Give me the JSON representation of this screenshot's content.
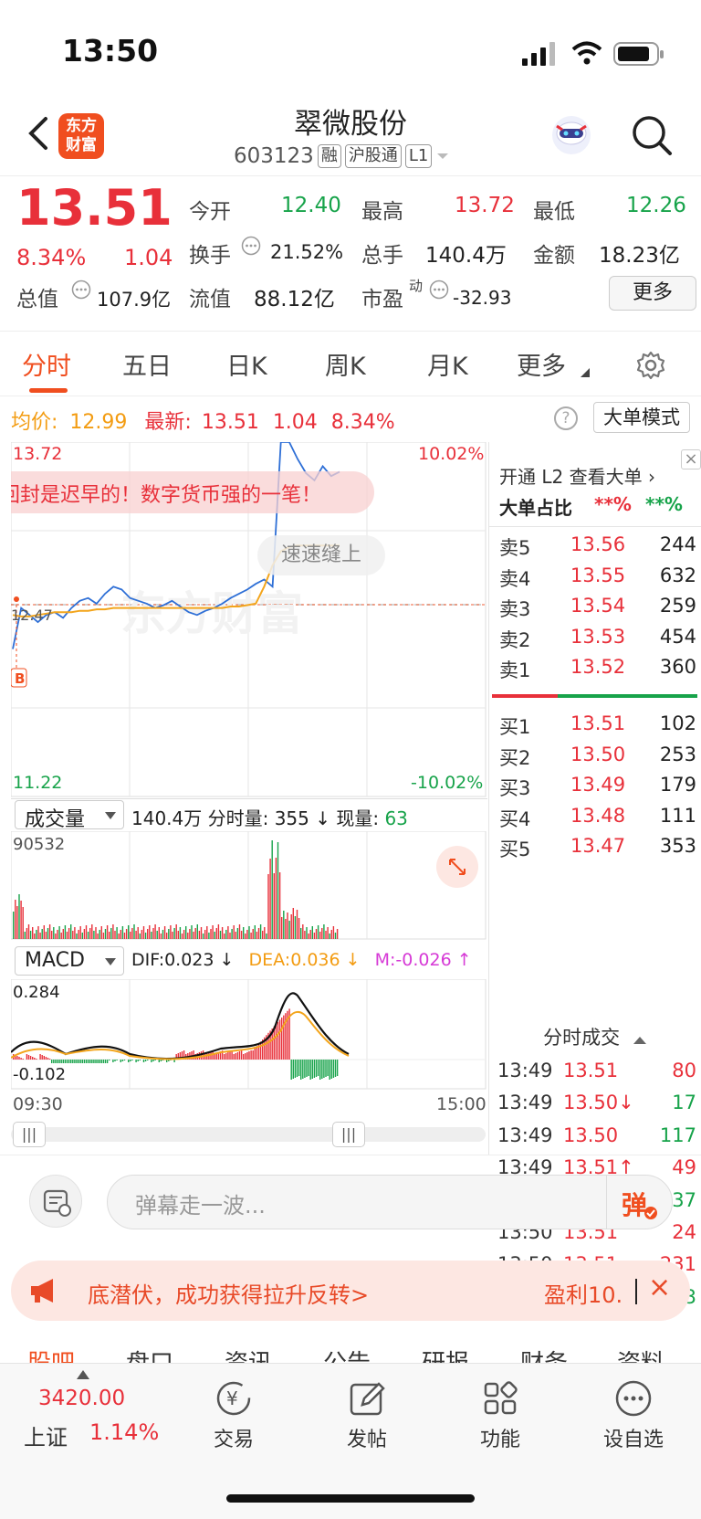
{
  "status": {
    "time": "13:50"
  },
  "header": {
    "logo_text_1": "东方",
    "logo_text_2": "财富",
    "stock_name": "翠微股份",
    "stock_code": "603123",
    "tags": [
      "融",
      "沪股通",
      "L1"
    ]
  },
  "quote": {
    "price": "13.51",
    "change_pct": "8.34%",
    "change": "1.04",
    "open_label": "今开",
    "open": "12.40",
    "high_label": "最高",
    "high": "13.72",
    "low_label": "最低",
    "low": "12.26",
    "turnover_label": "换手",
    "turnover": "21.52%",
    "volume_label": "总手",
    "volume": "140.4万",
    "amount_label": "金额",
    "amount": "18.23亿",
    "mktcap_label": "总值",
    "mktcap": "107.9亿",
    "float_label": "流值",
    "float_cap": "88.12亿",
    "pe_label": "市盈",
    "pe_sup": "动",
    "pe": "-32.93",
    "more_label": "更多"
  },
  "tabs": [
    {
      "label": "分时",
      "active": true
    },
    {
      "label": "五日"
    },
    {
      "label": "日K"
    },
    {
      "label": "周K"
    },
    {
      "label": "月K"
    },
    {
      "label": "更多"
    }
  ],
  "avg_row": {
    "avg_label": "均价:",
    "avg": "12.99",
    "latest_label": "最新:",
    "latest": "13.51",
    "change": "1.04",
    "pct": "8.34%",
    "help": "?",
    "bigorder_label": "大单模式"
  },
  "chart": {
    "top_price": "13.72",
    "bottom_price": "11.22",
    "prev_close_label": "12.47",
    "top_pct": "10.02%",
    "bottom_pct": "-10.02%",
    "danmu_1": "回封是迟早的！数字货币强的一笔！",
    "danmu_2": "速速缝上",
    "watermark": "东方财富",
    "buy_marker": "B",
    "volume_dropdown": "成交量",
    "volume_info": "140.4万 分时量: 355 ↓ 现量: ",
    "volume_now": "63",
    "volume_max": "90532",
    "macd_dropdown": "MACD",
    "dif": "DIF:0.023 ↓",
    "dea": "DEA:0.036 ↓",
    "m": "M:-0.026 ↑",
    "macd_top": "0.284",
    "macd_bottom": "-0.102",
    "time_start": "09:30",
    "time_end": "15:00"
  },
  "chart_data": {
    "type": "line",
    "title": "",
    "ylim": [
      11.22,
      13.72
    ],
    "series": [
      {
        "values": [
          12.26,
          12.55,
          12.5,
          12.45,
          12.5,
          12.52,
          12.48,
          12.55,
          12.6,
          12.62,
          12.58,
          12.65,
          12.7,
          12.68,
          12.62,
          12.6,
          12.58,
          12.55,
          12.57,
          12.6,
          12.56,
          12.52,
          12.5,
          12.53,
          12.55,
          12.58,
          12.62,
          12.65,
          12.68,
          12.72,
          12.75,
          12.7,
          13.72,
          13.72,
          13.6,
          13.5,
          13.45,
          13.55,
          13.48,
          13.51
        ]
      },
      {
        "values": [
          12.5,
          12.49,
          12.49,
          12.5,
          12.51,
          12.52,
          12.52,
          12.52,
          12.53,
          12.53,
          12.54,
          12.54,
          12.55,
          12.55,
          12.55,
          12.55,
          12.55,
          12.55,
          12.55,
          12.55,
          12.55,
          12.55,
          12.55,
          12.55,
          12.55,
          12.55,
          12.56,
          12.56,
          12.57,
          12.58,
          12.7,
          12.85,
          12.95,
          12.98,
          12.99,
          12.99,
          12.99,
          12.99,
          12.99,
          12.99
        ]
      }
    ]
  },
  "right_panel": {
    "l2_label": "开通 L2 查看大单 ›",
    "big_ratio_label": "大单占比",
    "big_ratio_1": "**%",
    "big_ratio_2": "**%",
    "sells": [
      {
        "label": "卖5",
        "price": "13.56",
        "vol": "244"
      },
      {
        "label": "卖4",
        "price": "13.55",
        "vol": "632"
      },
      {
        "label": "卖3",
        "price": "13.54",
        "vol": "259"
      },
      {
        "label": "卖2",
        "price": "13.53",
        "vol": "454"
      },
      {
        "label": "卖1",
        "price": "13.52",
        "vol": "360"
      }
    ],
    "buys": [
      {
        "label": "买1",
        "price": "13.51",
        "vol": "102"
      },
      {
        "label": "买2",
        "price": "13.50",
        "vol": "253"
      },
      {
        "label": "买3",
        "price": "13.49",
        "vol": "179"
      },
      {
        "label": "买4",
        "price": "13.48",
        "vol": "111"
      },
      {
        "label": "买5",
        "price": "13.47",
        "vol": "353"
      }
    ],
    "ticks_label": "分时成交",
    "ticks": [
      {
        "time": "13:49",
        "price": "13.51",
        "vol": "80"
      },
      {
        "time": "13:49",
        "price": "13.50↓",
        "vol": "17"
      },
      {
        "time": "13:49",
        "price": "13.50",
        "vol": "117"
      },
      {
        "time": "13:49",
        "price": "13.51↑",
        "vol": "49"
      },
      {
        "time": "13:50",
        "price": "13.51",
        "vol": "37"
      },
      {
        "time": "13:50",
        "price": "13.51",
        "vol": "24"
      },
      {
        "time": "13:50",
        "price": "13.51",
        "vol": "231"
      },
      {
        "time": "13:50",
        "price": "13.51",
        "vol": "63"
      }
    ]
  },
  "danmu": {
    "placeholder": "弹幕走一波...",
    "send": "弹"
  },
  "promo": {
    "text": "底潜伏，成功获得拉升反转>",
    "profit": "盈利10.",
    "close": "×"
  },
  "subtabs": [
    "股吧",
    "盘口",
    "资讯",
    "公告",
    "研报",
    "财务",
    "资料"
  ],
  "bottom_nav": {
    "index_value": "3420.00",
    "index_name": "上证",
    "index_pct": "1.14%",
    "trade": "交易",
    "post": "发帖",
    "function": "功能",
    "watchlist": "设自选"
  }
}
